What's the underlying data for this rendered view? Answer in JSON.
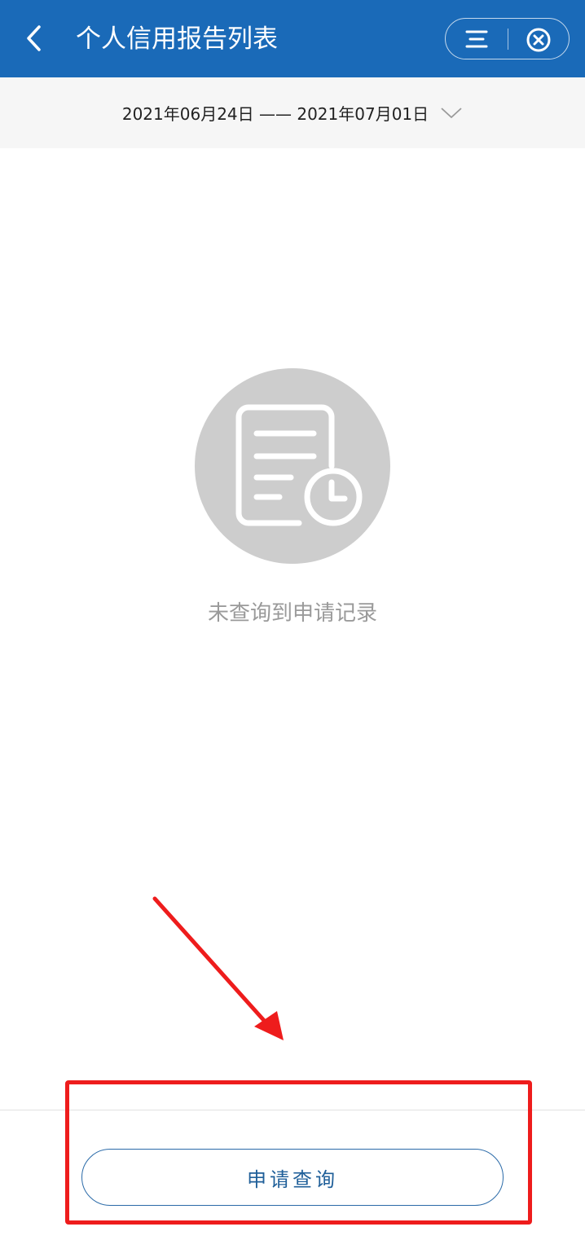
{
  "header": {
    "title": "个人信用报告列表",
    "back_icon": "chevron-left-icon",
    "menu_icon": "menu-icon",
    "close_icon": "close-circle-icon",
    "background_color": "#1a6ab8"
  },
  "date_range": {
    "text": "2021年06月24日 —— 2021年07月01日",
    "dropdown_icon": "chevron-down-icon"
  },
  "empty_state": {
    "icon": "document-clock-icon",
    "message": "未查询到申请记录"
  },
  "footer": {
    "apply_button_label": "申请查询"
  },
  "annotations": {
    "arrow_color": "#ee1c1c",
    "highlight_color": "#ee1c1c"
  }
}
